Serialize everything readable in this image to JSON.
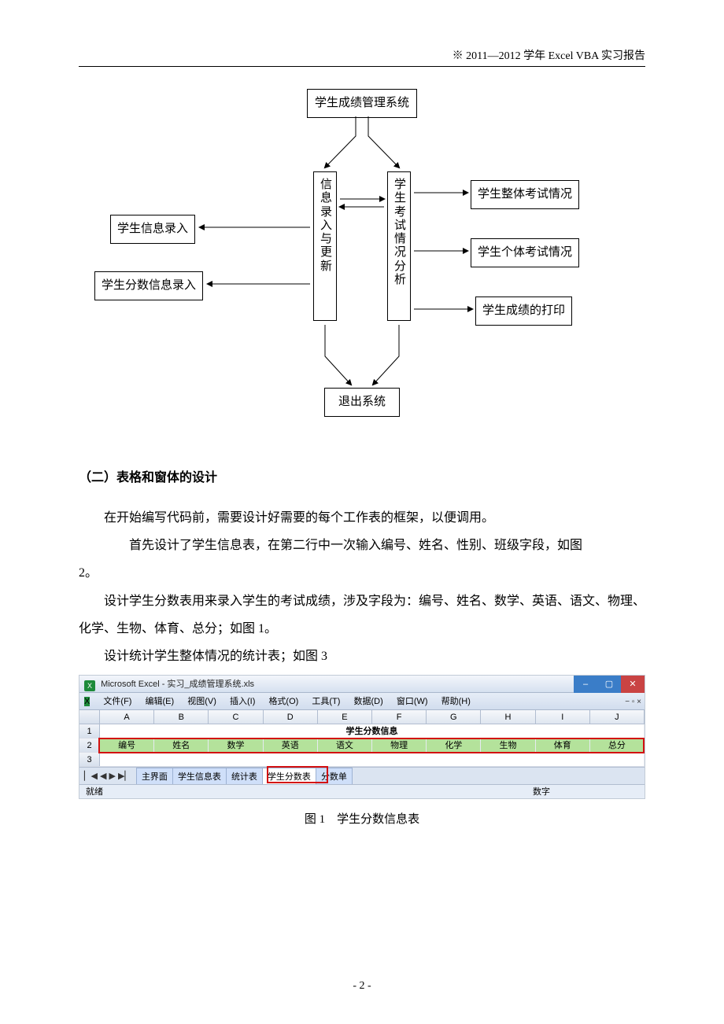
{
  "header": {
    "right_text": "※ 2011—2012 学年 Excel VBA 实习报告"
  },
  "diagram": {
    "top": "学生成绩管理系统",
    "left_mid": "信息录入与更新",
    "right_mid": "学生考试情况分析",
    "left_items": [
      "学生信息录入",
      "学生分数信息录入"
    ],
    "right_items": [
      "学生整体考试情况",
      "学生个体考试情况",
      "学生成绩的打印"
    ],
    "bottom": "退出系统"
  },
  "section_heading": "（二）表格和窗体的设计",
  "paragraphs": {
    "p1": "在开始编写代码前，需要设计好需要的每个工作表的框架，以便调用。",
    "p2": "首先设计了学生信息表，在第二行中一次输入编号、姓名、性别、班级字段，如图 2。",
    "p3": "设计学生分数表用来录入学生的考试成绩，涉及字段为：编号、姓名、数学、英语、语文、物理、化学、生物、体育、总分；如图 1。",
    "p4": "设计统计学生整体情况的统计表；如图 3"
  },
  "excel": {
    "title": "Microsoft Excel - 实习_成绩管理系统.xls",
    "menus": [
      "文件(F)",
      "编辑(E)",
      "视图(V)",
      "插入(I)",
      "格式(O)",
      "工具(T)",
      "数据(D)",
      "窗口(W)",
      "帮助(H)"
    ],
    "mdi_close": "− ▫ ×",
    "columns": [
      "A",
      "B",
      "C",
      "D",
      "E",
      "F",
      "G",
      "H",
      "I",
      "J"
    ],
    "row1_title": "学生分数信息",
    "row2": [
      "编号",
      "姓名",
      "数学",
      "英语",
      "语文",
      "物理",
      "化学",
      "生物",
      "体育",
      "总分"
    ],
    "tabs": [
      "主界面",
      "学生信息表",
      "统计表",
      "学生分数表",
      "分数单"
    ],
    "status_left": "就绪",
    "status_num": "数字"
  },
  "figure_caption": "图 1　学生分数信息表",
  "page_num": "- 2 -"
}
